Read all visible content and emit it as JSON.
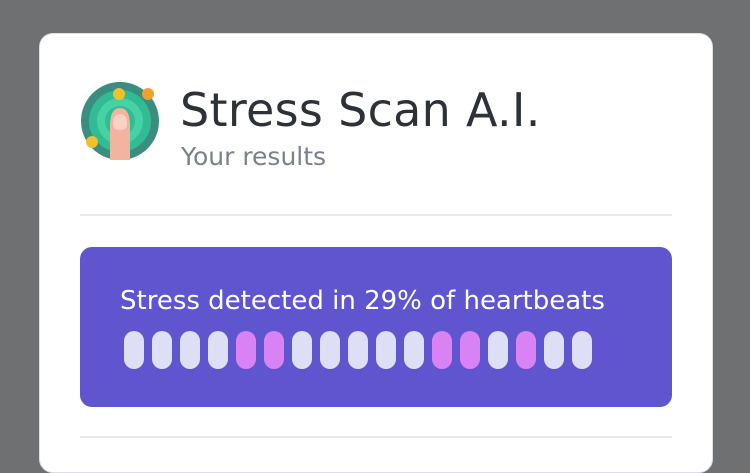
{
  "app": {
    "title": "Stress Scan A.I.",
    "subtitle": "Your results"
  },
  "results": {
    "summary": "Stress detected in 29% of heartbeats",
    "heartbeats": [
      false,
      false,
      false,
      false,
      true,
      true,
      false,
      false,
      false,
      false,
      false,
      true,
      true,
      false,
      true,
      false,
      false
    ]
  },
  "colors": {
    "background": "#6f7072",
    "panel": "#5e55cf",
    "stress_beat": "#d882f4",
    "normal_beat": "#dedff5"
  }
}
